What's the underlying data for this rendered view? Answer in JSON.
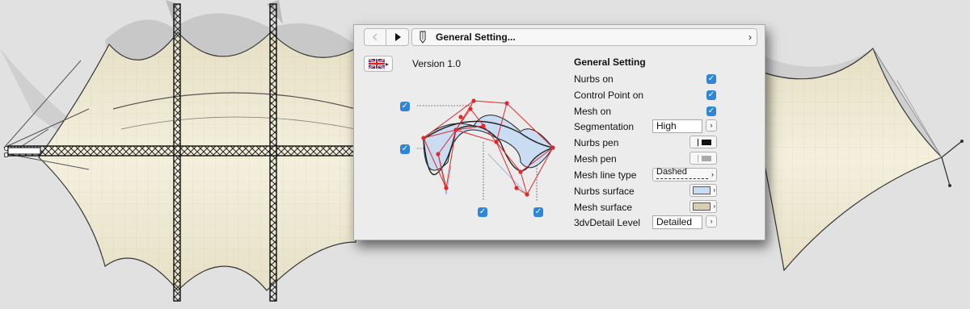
{
  "toolbar": {
    "back_icon": "chevron-left-icon",
    "forward_icon": "play-right-icon",
    "title": "General Setting...",
    "title_icon": "pen-icon",
    "menu_icon": "chevron-right-icon"
  },
  "language": {
    "flag_icon": "uk-flag-icon"
  },
  "version": "Version 1.0",
  "settings": {
    "header": "General Setting",
    "nurbs_on": {
      "label": "Nurbs on",
      "checked": true
    },
    "control_point_on": {
      "label": "Control Point on",
      "checked": true
    },
    "mesh_on": {
      "label": "Mesh on",
      "checked": true
    },
    "segmentation": {
      "label": "Segmentation",
      "value": "High"
    },
    "nurbs_pen": {
      "label": "Nurbs pen",
      "color": "#111111"
    },
    "mesh_pen": {
      "label": "Mesh pen",
      "color": "#aaaaaa"
    },
    "mesh_line_type": {
      "label": "Mesh line type",
      "value": "Dashed"
    },
    "nurbs_surface": {
      "label": "Nurbs surface",
      "color": "#c9dcf2"
    },
    "mesh_surface": {
      "label": "Mesh surface",
      "color": "#d7ceb4"
    },
    "detail_level": {
      "label": "3dvDetail Level",
      "value": "Detailed"
    }
  },
  "colors": {
    "accent": "#2f86d8",
    "control_polygon": "#e0282c",
    "surface_fill": "#c9dcf2",
    "membrane": "#efe9d4"
  }
}
